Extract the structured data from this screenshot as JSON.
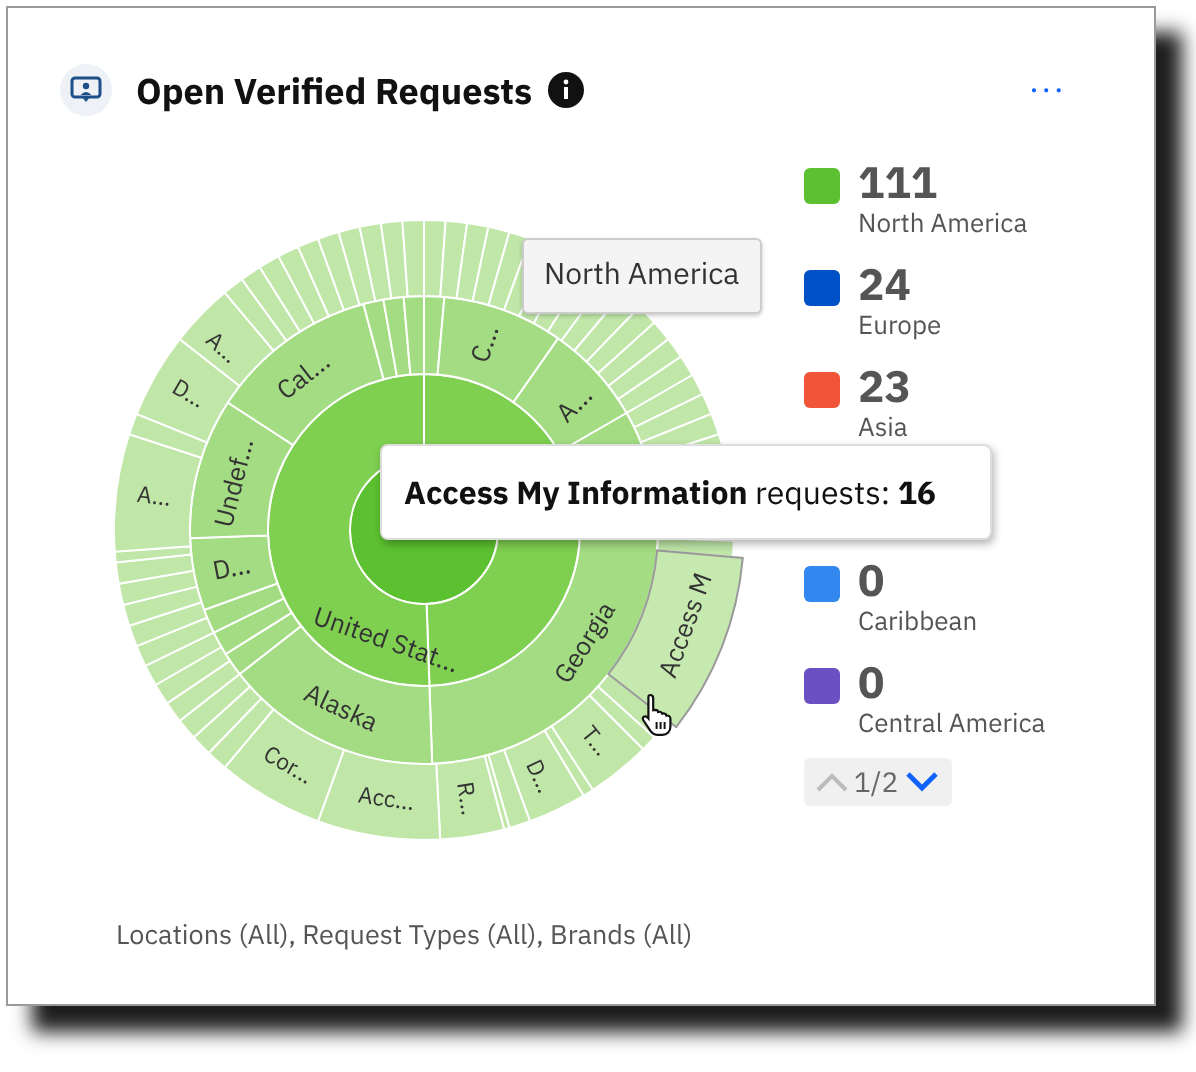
{
  "widget": {
    "title": "Open Verified Requests",
    "menu": "···"
  },
  "chart": {
    "labels": [
      "A...",
      "D...",
      "Cal...",
      "Undef...",
      "A...",
      "D...",
      "C...",
      "A...",
      "United Stat...",
      "Alaska",
      "Georgia",
      "Access M",
      "Cor...",
      "Acc...",
      "R...",
      "D...",
      "T..."
    ],
    "hover_tooltip": "North America",
    "detail_tooltip": "**Access My Information** requests: **16**"
  },
  "legend": {
    "items": [
      {
        "count": "111",
        "name": "North America",
        "color": "#5cc130"
      },
      {
        "count": "24",
        "name": "Europe",
        "color": "#0050c8"
      },
      {
        "count": "23",
        "name": "Asia",
        "color": "#f0553a"
      },
      {
        "count": "0",
        "name": "Caribbean",
        "color": "#3388f0"
      },
      {
        "count": "0",
        "name": "Central America",
        "color": "#6a50c0"
      }
    ],
    "pager": {
      "text": "1/2",
      "previous_disabled": true,
      "next_disabled": false
    }
  },
  "filters": "Locations (All), Request Types (All), Brands (All)"
}
